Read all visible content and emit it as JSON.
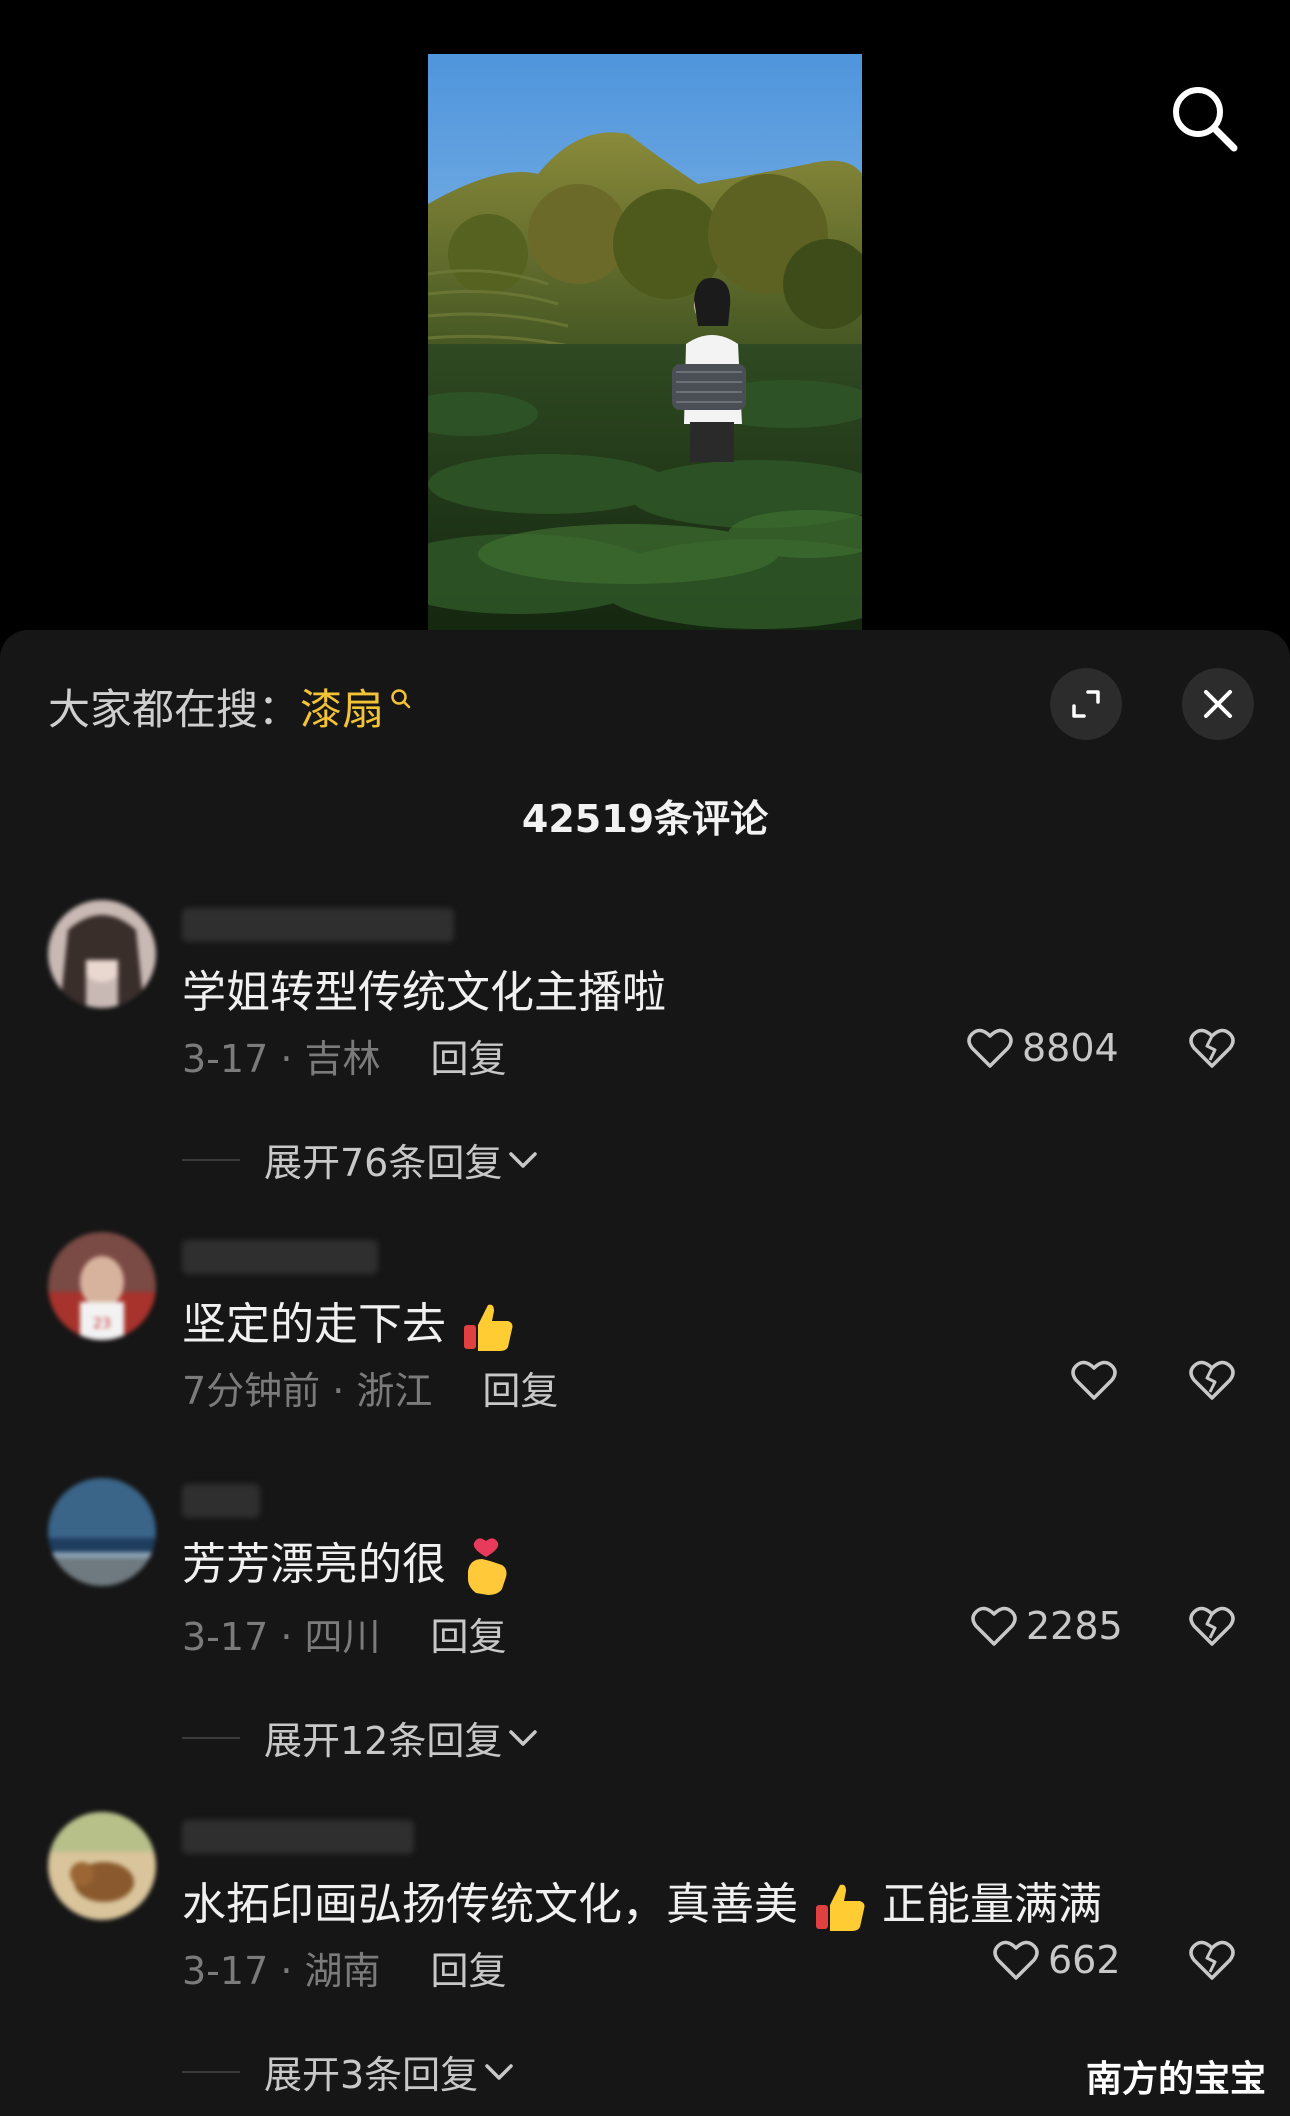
{
  "header": {
    "search_icon": "search-icon"
  },
  "trending": {
    "prefix": "大家都在搜：",
    "keyword": "漆扇",
    "keyword_icon": "search-small-icon"
  },
  "sheet_controls": {
    "expand_icon": "expand-icon",
    "close_icon": "close-icon"
  },
  "comment_count": "42519条评论",
  "comments": [
    {
      "text": "学姐转型传统文化主播啦",
      "time_location": "3-17 · 吉林",
      "reply_label": "回复",
      "likes": "8804",
      "expand_label": "展开76条回复"
    },
    {
      "text": "坚定的走下去",
      "emoji": "thumbs-up",
      "time_location": "7分钟前 · 浙江",
      "reply_label": "回复",
      "likes": "",
      "expand_label": ""
    },
    {
      "text": "芳芳漂亮的很",
      "emoji": "finger-heart",
      "time_location": "3-17 · 四川",
      "reply_label": "回复",
      "likes": "2285",
      "expand_label": "展开12条回复"
    },
    {
      "text_before": "水拓印画弘扬传统文化，真善美",
      "emoji": "thumbs-up",
      "text_after": "正能量满满",
      "time_location": "3-17 · 湖南",
      "reply_label": "回复",
      "likes": "662",
      "expand_label": "展开3条回复"
    }
  ],
  "watermark": "南方的宝宝",
  "colors": {
    "sheet_bg": "#161616",
    "keyword": "#f2c335",
    "meta_gray": "#7b7b7b",
    "text": "#f0f0f0"
  }
}
